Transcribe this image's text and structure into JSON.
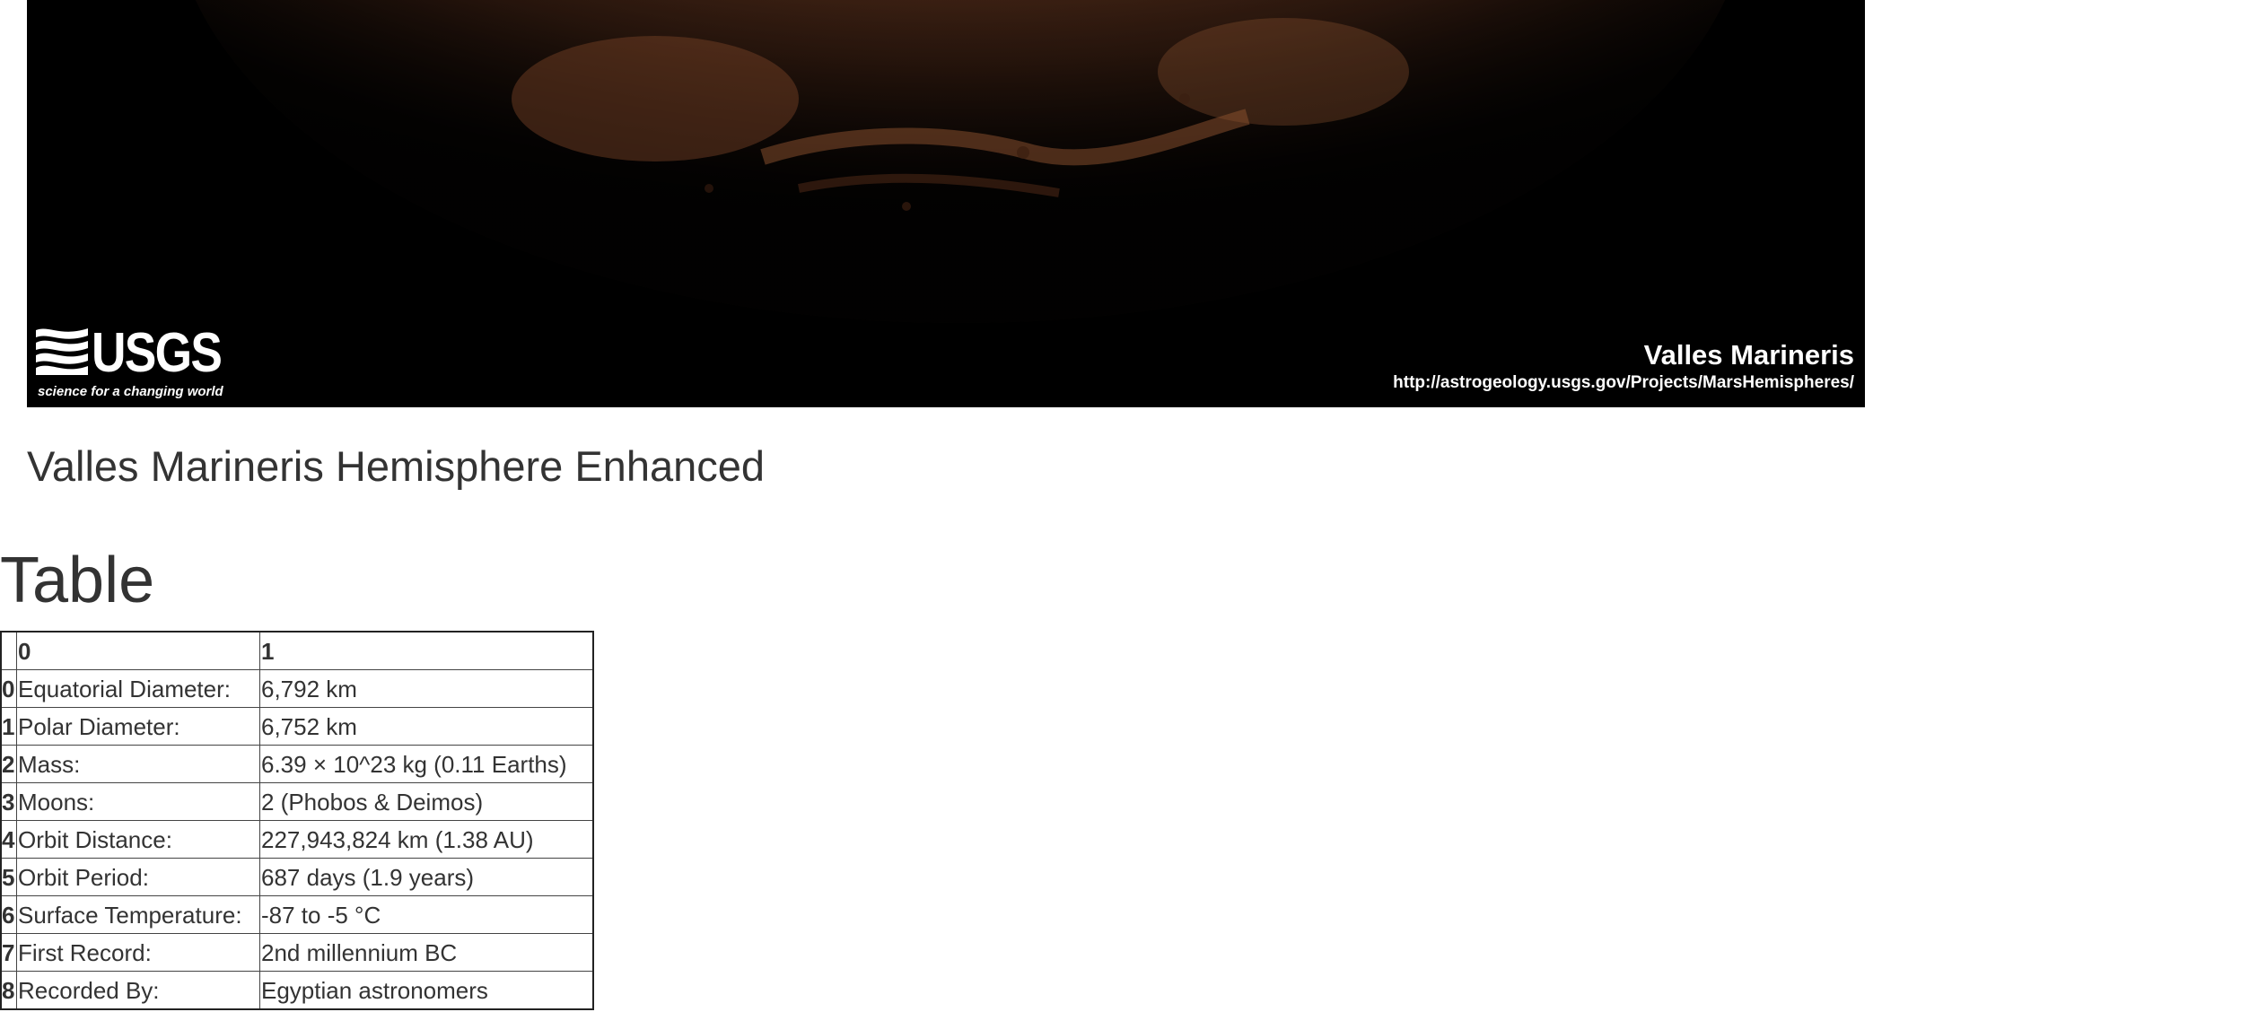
{
  "hero": {
    "logo_text": "USGS",
    "logo_tagline": "science for a changing world",
    "caption_name": "Valles Marineris",
    "caption_url": "http://astrogeology.usgs.gov/Projects/MarsHemispheres/"
  },
  "hemisphere_title": "Valles Marineris Hemisphere Enhanced",
  "table_heading": "Table",
  "table": {
    "columns": [
      "",
      "0",
      "1"
    ],
    "rows": [
      {
        "index": "0",
        "label": "Equatorial Diameter:",
        "value": "6,792 km"
      },
      {
        "index": "1",
        "label": "Polar Diameter:",
        "value": "6,752 km"
      },
      {
        "index": "2",
        "label": "Mass:",
        "value": "6.39 × 10^23 kg (0.11 Earths)"
      },
      {
        "index": "3",
        "label": "Moons:",
        "value": "2 (Phobos & Deimos)"
      },
      {
        "index": "4",
        "label": "Orbit Distance:",
        "value": "227,943,824 km (1.38 AU)"
      },
      {
        "index": "5",
        "label": "Orbit Period:",
        "value": "687 days (1.9 years)"
      },
      {
        "index": "6",
        "label": "Surface Temperature:",
        "value": "-87 to -5 °C"
      },
      {
        "index": "7",
        "label": "First Record:",
        "value": "2nd millennium BC"
      },
      {
        "index": "8",
        "label": "Recorded By:",
        "value": "Egyptian astronomers"
      }
    ]
  },
  "colors": {
    "mars_surface": "#6b3a22",
    "mars_highlight": "#8a4e2e",
    "background": "#ffffff",
    "text": "#333333"
  }
}
